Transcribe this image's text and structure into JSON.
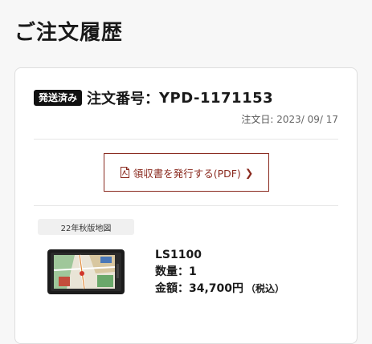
{
  "page": {
    "title": "ご注文履歴"
  },
  "order": {
    "status": "発送済み",
    "number_label": "注文番号：",
    "number": "YPD-1171153",
    "date_label": "注文日: ",
    "date": "2023/ 09/ 17",
    "receipt_button": "領収書を発行する(PDF)",
    "receipt_chevron": "❯",
    "receipt_icon": "pdf-file-icon"
  },
  "product": {
    "tag": "22年秋版地図",
    "name": "LS1100",
    "quantity_label": "数量：",
    "quantity": "1",
    "price_label": "金額：",
    "price": "34,700円",
    "tax_note": "（税込）",
    "image_icon": "car-navigation-device"
  },
  "colors": {
    "accent": "#8a2a1f",
    "badge_bg": "#111111",
    "card_border": "#dedede",
    "page_bg": "#f7f7f7"
  }
}
